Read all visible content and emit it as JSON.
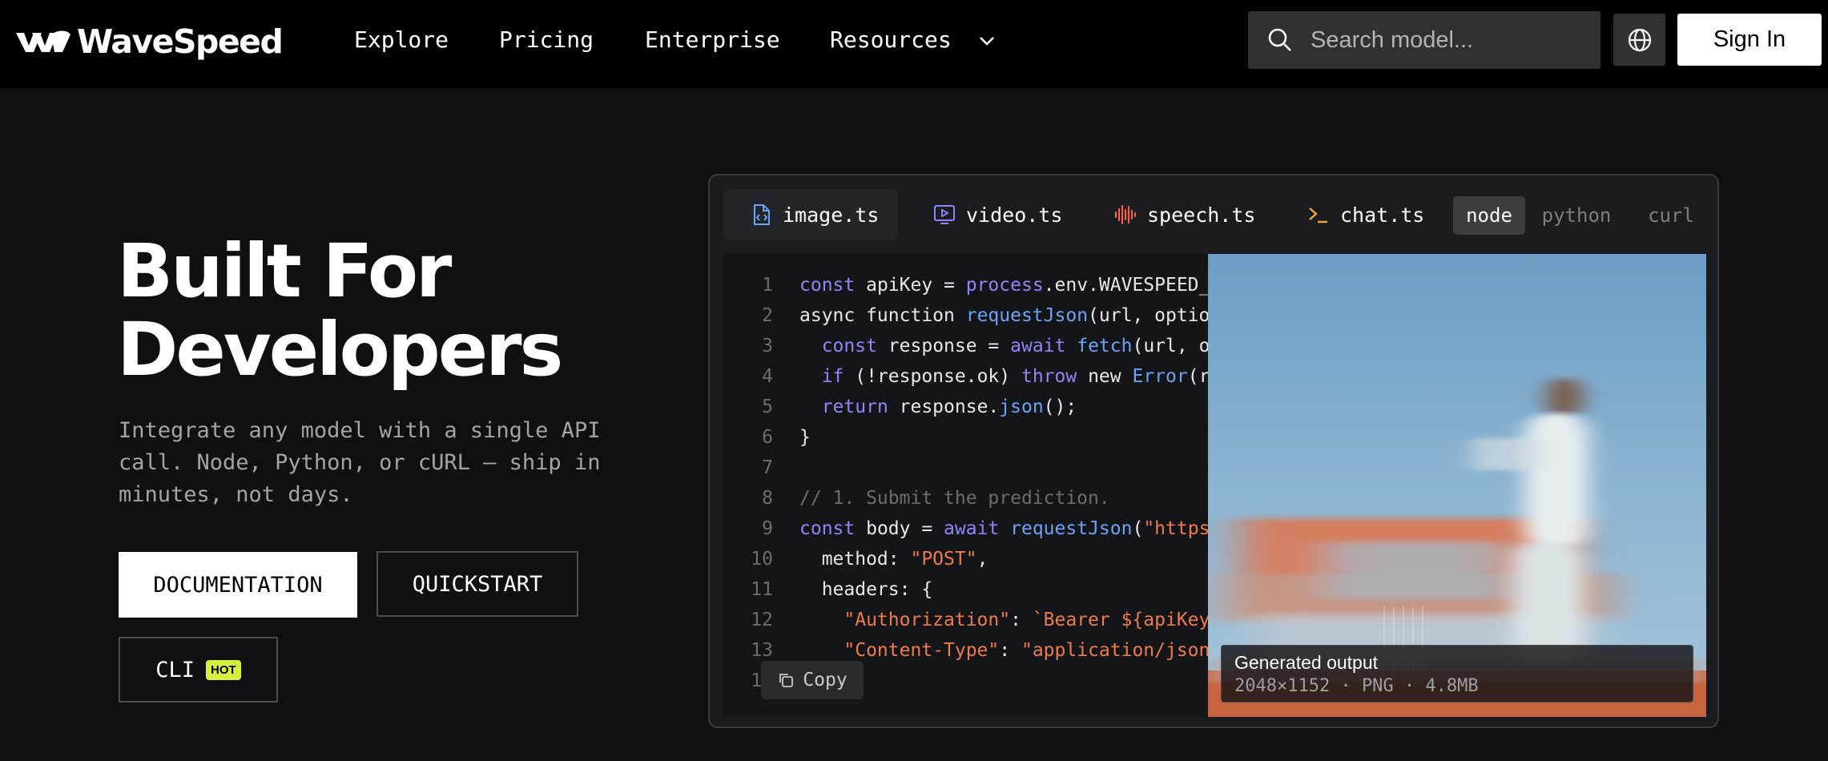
{
  "nav": {
    "brand": "WaveSpeed",
    "links": [
      "Explore",
      "Pricing",
      "Enterprise",
      "Resources"
    ],
    "search_placeholder": "Search model...",
    "sign_in": "Sign In"
  },
  "hero": {
    "title_line1": "Built For",
    "title_line2": "Developers",
    "subtitle": "Integrate any model with a single API call. Node, Python, or cURL — ship in minutes, not days.",
    "buttons": {
      "documentation": "DOCUMENTATION",
      "quickstart": "QUICKSTART",
      "cli": "CLI",
      "cli_badge": "HOT"
    }
  },
  "panel": {
    "tabs": [
      "image.ts",
      "video.ts",
      "speech.ts",
      "chat.ts"
    ],
    "languages": [
      "node",
      "python",
      "curl"
    ],
    "active_language": "node",
    "copy_label": "Copy",
    "code_lines": [
      [
        [
          "kw",
          "const"
        ],
        [
          "t",
          " apiKey = "
        ],
        [
          "kw",
          "process"
        ],
        [
          "t",
          ".env.WAVESPEED_API_KEY;"
        ]
      ],
      [
        [
          "t",
          "async function "
        ],
        [
          "fn",
          "requestJson"
        ],
        [
          "t",
          "(url, options) {"
        ]
      ],
      [
        [
          "t",
          "  "
        ],
        [
          "kw",
          "const"
        ],
        [
          "t",
          " response = "
        ],
        [
          "kw",
          "await"
        ],
        [
          "t",
          " "
        ],
        [
          "fn",
          "fetch"
        ],
        [
          "t",
          "(url, options);"
        ]
      ],
      [
        [
          "t",
          "  "
        ],
        [
          "kw",
          "if"
        ],
        [
          "t",
          " (!response.ok) "
        ],
        [
          "kw",
          "throw"
        ],
        [
          "t",
          " new "
        ],
        [
          "fn",
          "Error"
        ],
        [
          "t",
          "(response.statusText);"
        ]
      ],
      [
        [
          "t",
          "  "
        ],
        [
          "kw",
          "return"
        ],
        [
          "t",
          " response."
        ],
        [
          "fn",
          "json"
        ],
        [
          "t",
          "();"
        ]
      ],
      [
        [
          "t",
          "}"
        ]
      ],
      [
        [
          "t",
          ""
        ]
      ],
      [
        [
          "cm",
          "// 1. Submit the prediction."
        ]
      ],
      [
        [
          "kw",
          "const"
        ],
        [
          "t",
          " body = "
        ],
        [
          "kw",
          "await"
        ],
        [
          "t",
          " "
        ],
        [
          "fn",
          "requestJson"
        ],
        [
          "t",
          "("
        ],
        [
          "str",
          "\"https://api.wavespeed.ai\""
        ],
        [
          "t",
          ", {"
        ]
      ],
      [
        [
          "t",
          "  method: "
        ],
        [
          "str",
          "\"POST\""
        ],
        [
          "t",
          ","
        ]
      ],
      [
        [
          "t",
          "  headers: {"
        ]
      ],
      [
        [
          "t",
          "    "
        ],
        [
          "str",
          "\"Authorization\""
        ],
        [
          "t",
          ": "
        ],
        [
          "str",
          "`Bearer ${apiKey}`"
        ],
        [
          "t",
          ","
        ]
      ],
      [
        [
          "t",
          "    "
        ],
        [
          "str",
          "\"Content-Type\""
        ],
        [
          "t",
          ": "
        ],
        [
          "str",
          "\"application/json\""
        ],
        [
          "t",
          ","
        ]
      ],
      [
        [
          "t",
          "  },"
        ]
      ]
    ],
    "output": {
      "title": "Generated output",
      "meta": "2048×1152 · PNG · 4.8MB"
    }
  },
  "colors": {
    "accent_keyword": "#8d87f6",
    "accent_function": "#6ca3f5",
    "accent_string": "#f07a4a",
    "badge_hot": "#d8ef3e"
  }
}
